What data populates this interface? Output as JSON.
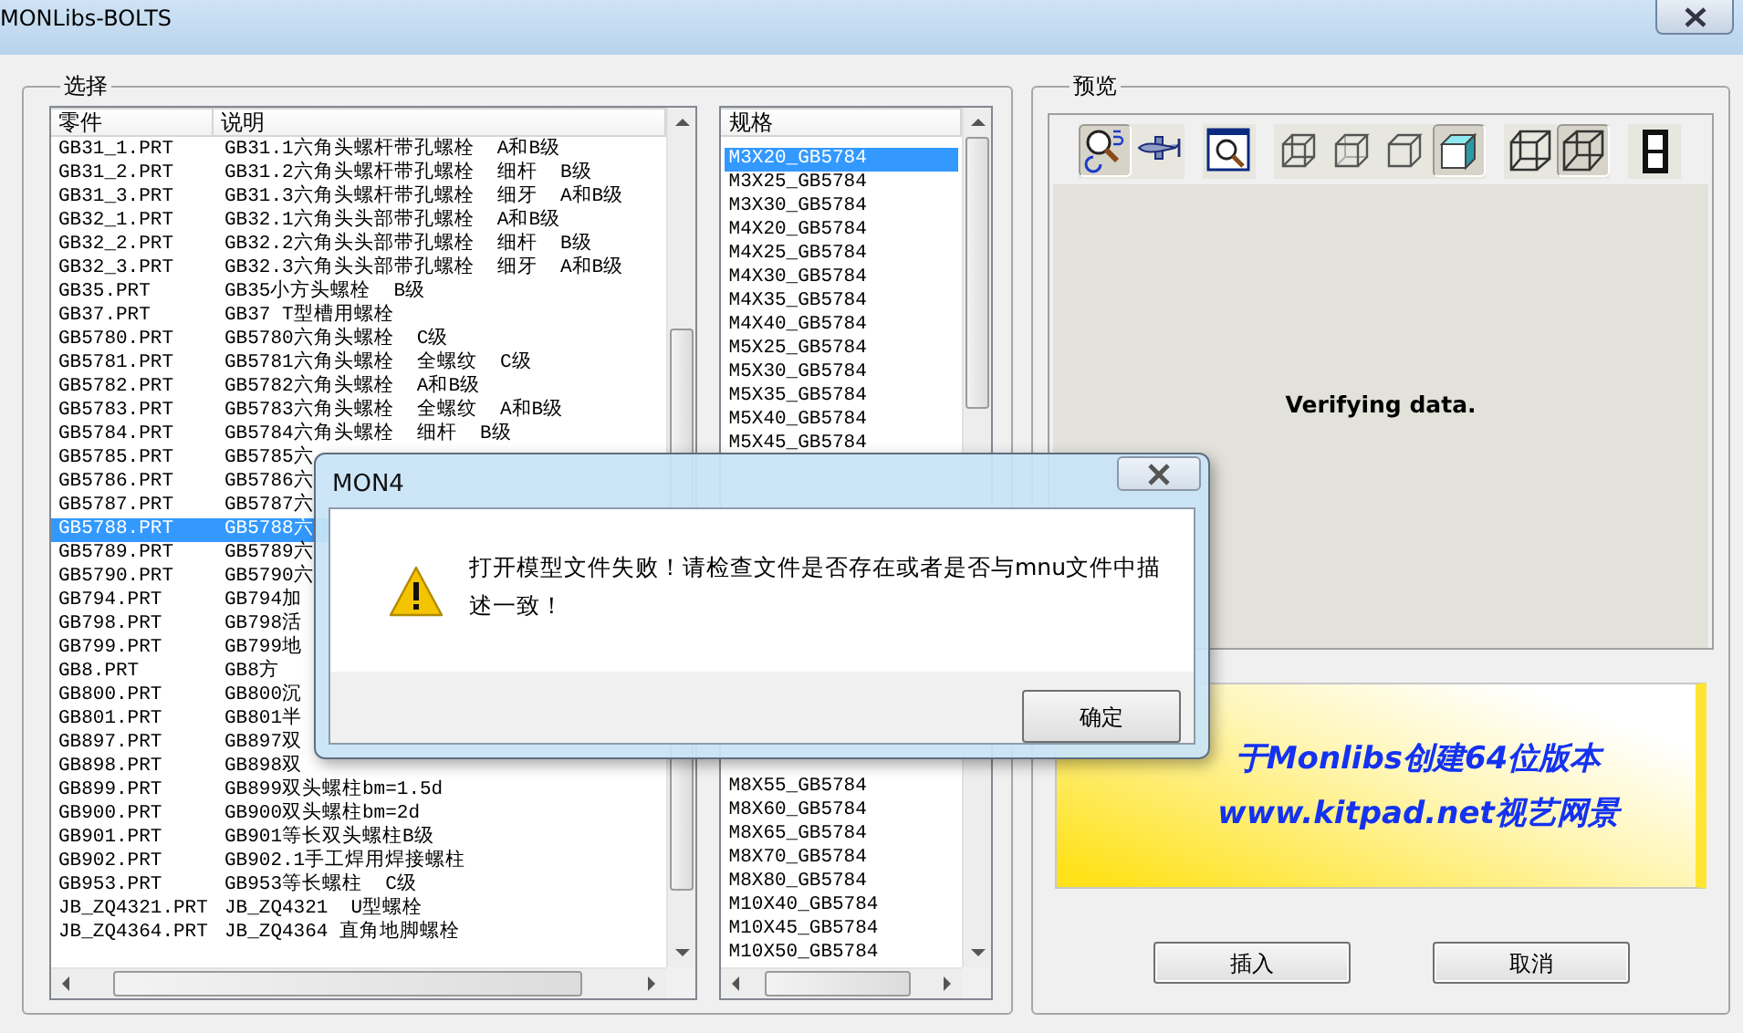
{
  "window": {
    "title": "MONLibs-BOLTS"
  },
  "select_group": {
    "label": "选择",
    "parts_list": {
      "columns": [
        "零件",
        "说明"
      ],
      "rows": [
        {
          "part": "GB31_1.PRT",
          "description": "GB31.1六角头螺杆带孔螺栓  A和B级",
          "selected": false
        },
        {
          "part": "GB31_2.PRT",
          "description": "GB31.2六角头螺杆带孔螺栓  细杆  B级",
          "selected": false
        },
        {
          "part": "GB31_3.PRT",
          "description": "GB31.3六角头螺杆带孔螺栓  细牙  A和B级",
          "selected": false
        },
        {
          "part": "GB32_1.PRT",
          "description": "GB32.1六角头头部带孔螺栓  A和B级",
          "selected": false
        },
        {
          "part": "GB32_2.PRT",
          "description": "GB32.2六角头头部带孔螺栓  细杆  B级",
          "selected": false
        },
        {
          "part": "GB32_3.PRT",
          "description": "GB32.3六角头头部带孔螺栓  细牙  A和B级",
          "selected": false
        },
        {
          "part": "GB35.PRT",
          "description": "GB35小方头螺栓  B级",
          "selected": false
        },
        {
          "part": "GB37.PRT",
          "description": "GB37 T型槽用螺栓",
          "selected": false
        },
        {
          "part": "GB5780.PRT",
          "description": "GB5780六角头螺栓  C级",
          "selected": false
        },
        {
          "part": "GB5781.PRT",
          "description": "GB5781六角头螺栓  全螺纹  C级",
          "selected": false
        },
        {
          "part": "GB5782.PRT",
          "description": "GB5782六角头螺栓  A和B级",
          "selected": false
        },
        {
          "part": "GB5783.PRT",
          "description": "GB5783六角头螺栓  全螺纹  A和B级",
          "selected": false
        },
        {
          "part": "GB5784.PRT",
          "description": "GB5784六角头螺栓  细杆  B级",
          "selected": false
        },
        {
          "part": "GB5785.PRT",
          "description": "GB5785六",
          "selected": false
        },
        {
          "part": "GB5786.PRT",
          "description": "GB5786六",
          "selected": false
        },
        {
          "part": "GB5787.PRT",
          "description": "GB5787六",
          "selected": false
        },
        {
          "part": "GB5788.PRT",
          "description": "GB5788六",
          "selected": true
        },
        {
          "part": "GB5789.PRT",
          "description": "GB5789六",
          "selected": false
        },
        {
          "part": "GB5790.PRT",
          "description": "GB5790六",
          "selected": false
        },
        {
          "part": "GB794.PRT",
          "description": "GB794加",
          "selected": false
        },
        {
          "part": "GB798.PRT",
          "description": "GB798活",
          "selected": false
        },
        {
          "part": "GB799.PRT",
          "description": "GB799地",
          "selected": false
        },
        {
          "part": "GB8.PRT",
          "description": "GB8方",
          "selected": false
        },
        {
          "part": "GB800.PRT",
          "description": "GB800沉",
          "selected": false
        },
        {
          "part": "GB801.PRT",
          "description": "GB801半",
          "selected": false
        },
        {
          "part": "GB897.PRT",
          "description": "GB897双",
          "selected": false
        },
        {
          "part": "GB898.PRT",
          "description": "GB898双",
          "selected": false
        },
        {
          "part": "GB899.PRT",
          "description": "GB899双头螺柱bm=1.5d",
          "selected": false
        },
        {
          "part": "GB900.PRT",
          "description": "GB900双头螺柱bm=2d",
          "selected": false
        },
        {
          "part": "GB901.PRT",
          "description": "GB901等长双头螺柱B级",
          "selected": false
        },
        {
          "part": "GB902.PRT",
          "description": "GB902.1手工焊用焊接螺柱",
          "selected": false
        },
        {
          "part": "GB953.PRT",
          "description": "GB953等长螺柱  C级",
          "selected": false
        },
        {
          "part": "JB_ZQ4321.PRT",
          "description": "JB_ZQ4321  U型螺栓",
          "selected": false
        },
        {
          "part": "JB_ZQ4364.PRT",
          "description": "JB_ZQ4364 直角地脚螺栓",
          "selected": false
        }
      ]
    },
    "spec_list": {
      "column": "规格",
      "rows_top": [
        {
          "label": "M3X20_GB5784",
          "selected": true
        },
        {
          "label": "M3X25_GB5784",
          "selected": false
        },
        {
          "label": "M3X30_GB5784",
          "selected": false
        },
        {
          "label": "M4X20_GB5784",
          "selected": false
        },
        {
          "label": "M4X25_GB5784",
          "selected": false
        },
        {
          "label": "M4X30_GB5784",
          "selected": false
        },
        {
          "label": "M4X35_GB5784",
          "selected": false
        },
        {
          "label": "M4X40_GB5784",
          "selected": false
        },
        {
          "label": "M5X25_GB5784",
          "selected": false
        },
        {
          "label": "M5X30_GB5784",
          "selected": false
        },
        {
          "label": "M5X35_GB5784",
          "selected": false
        },
        {
          "label": "M5X40_GB5784",
          "selected": false
        },
        {
          "label": "M5X45_GB5784",
          "selected": false
        }
      ],
      "rows_bottom": [
        {
          "label": "M8X55_GB5784",
          "selected": false
        },
        {
          "label": "M8X60_GB5784",
          "selected": false
        },
        {
          "label": "M8X65_GB5784",
          "selected": false
        },
        {
          "label": "M8X70_GB5784",
          "selected": false
        },
        {
          "label": "M8X80_GB5784",
          "selected": false
        },
        {
          "label": "M10X40_GB5784",
          "selected": false
        },
        {
          "label": "M10X45_GB5784",
          "selected": false
        },
        {
          "label": "M10X50_GB5784",
          "selected": false
        }
      ]
    }
  },
  "preview_group": {
    "label": "预览",
    "toolbar": [
      [
        {
          "kind": "zoom-rotate",
          "pressed": true
        },
        {
          "kind": "fly",
          "pressed": false
        }
      ],
      [
        {
          "kind": "zoom-window",
          "pressed": false
        }
      ],
      [
        {
          "kind": "wireframe",
          "pressed": false
        },
        {
          "kind": "hidden-gray",
          "pressed": false
        },
        {
          "kind": "no-hidden",
          "pressed": false
        },
        {
          "kind": "shaded",
          "pressed": true
        }
      ],
      [
        {
          "kind": "perspective-off",
          "pressed": false
        },
        {
          "kind": "perspective-on",
          "pressed": true
        }
      ],
      [
        {
          "kind": "film",
          "pressed": false
        }
      ]
    ],
    "status": "Verifying data.",
    "banner": [
      "于Monlibs创建64位版本",
      "www.kitpad.net视艺网景"
    ]
  },
  "buttons": [
    "插入",
    "取消"
  ],
  "dialog": {
    "title": "MON4",
    "message": "打开模型文件失败！请检查文件是否存在或者是否与mnu文件中描述一致！",
    "button": "确定"
  }
}
